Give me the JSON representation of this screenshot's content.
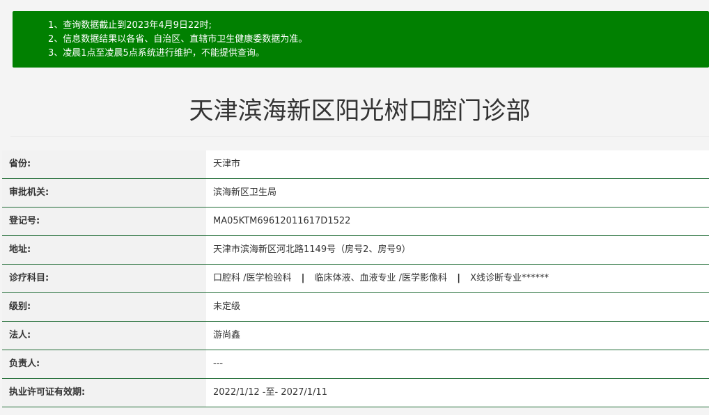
{
  "notice": {
    "lines": [
      "1、查询数据截止到2023年4月9日22时;",
      "2、信息数据结果以各省、自治区、直辖市卫生健康委数据为准。",
      "3、凌晨1点至凌晨5点系统进行维护，不能提供查询。"
    ]
  },
  "title": "天津滨海新区阳光树口腔门诊部",
  "rows": [
    {
      "label": "省份:",
      "value": "天津市"
    },
    {
      "label": "审批机关:",
      "value": "滨海新区卫生局"
    },
    {
      "label": "登记号:",
      "value": "MA05KTM69612011617D1522"
    },
    {
      "label": "地址:",
      "value": "天津市滨海新区河北路1149号（房号2、房号9）"
    },
    {
      "label": "诊疗科目:",
      "value": "",
      "items": [
        "口腔科 /医学检验科",
        "临床体液、血液专业 /医学影像科",
        "X线诊断专业******"
      ],
      "separator": "|"
    },
    {
      "label": "级别:",
      "value": "未定级"
    },
    {
      "label": "法人:",
      "value": "游尚鑫"
    },
    {
      "label": "负责人:",
      "value": "---"
    },
    {
      "label": "执业许可证有效期:",
      "value": "2022/1/12 -至- 2027/1/11"
    }
  ],
  "colors": {
    "notice_bg": "#018001",
    "row_border": "#1d6a33",
    "label_bg": "#f2f2f2"
  }
}
